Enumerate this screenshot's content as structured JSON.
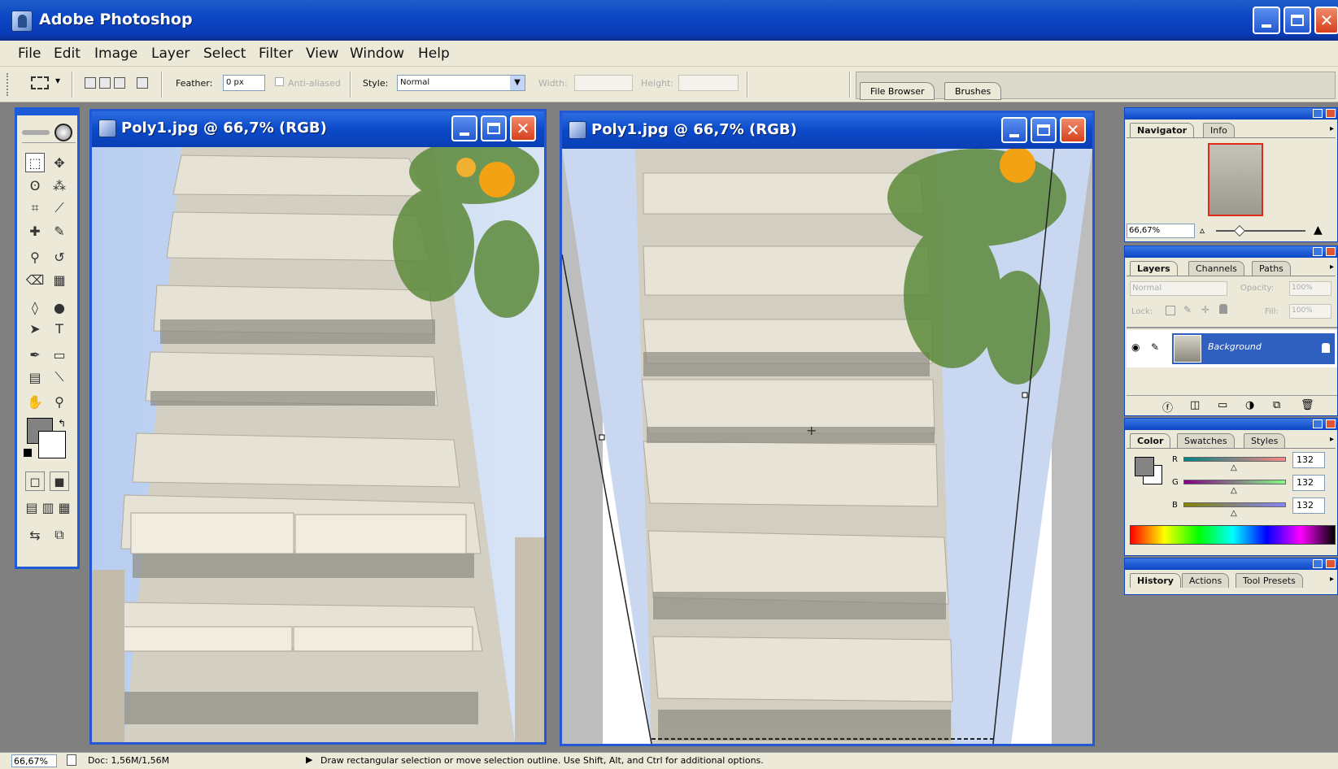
{
  "app": {
    "title": "Adobe Photoshop"
  },
  "menu": [
    "File",
    "Edit",
    "Image",
    "Layer",
    "Select",
    "Filter",
    "View",
    "Window",
    "Help"
  ],
  "options": {
    "feather_label": "Feather:",
    "feather_value": "0 px",
    "antialiased_label": "Anti-aliased",
    "style_label": "Style:",
    "style_value": "Normal",
    "width_label": "Width:",
    "height_label": "Height:",
    "well_tabs": [
      "File Browser",
      "Brushes"
    ]
  },
  "documents": [
    {
      "title": "Poly1.jpg @ 66,7% (RGB)"
    },
    {
      "title": "Poly1.jpg @ 66,7% (RGB)"
    }
  ],
  "navigator": {
    "tabs": [
      "Navigator",
      "Info"
    ],
    "zoom": "66,67%"
  },
  "layers": {
    "tabs": [
      "Layers",
      "Channels",
      "Paths"
    ],
    "blend_mode": "Normal",
    "opacity_label": "Opacity:",
    "opacity_value": "100%",
    "lock_label": "Lock:",
    "fill_label": "Fill:",
    "fill_value": "100%",
    "layer_name": "Background"
  },
  "color": {
    "tabs": [
      "Color",
      "Swatches",
      "Styles"
    ],
    "r_label": "R",
    "g_label": "G",
    "b_label": "B",
    "r_value": "132",
    "g_value": "132",
    "b_value": "132",
    "foreground": "#848484"
  },
  "history": {
    "tabs": [
      "History",
      "Actions",
      "Tool Presets"
    ]
  },
  "status": {
    "zoom": "66,67%",
    "doc": "Doc: 1,56M/1,56M",
    "hint": "Draw rectangular selection or move selection outline.  Use Shift, Alt, and Ctrl for additional options."
  }
}
